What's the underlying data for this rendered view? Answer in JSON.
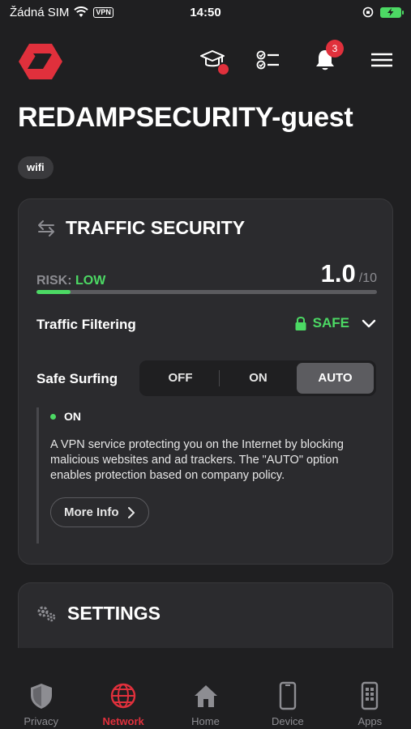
{
  "status_bar": {
    "carrier": "Žádná SIM",
    "vpn": "VPN",
    "time": "14:50"
  },
  "header": {
    "notification_count": "3"
  },
  "page": {
    "title": "REDAMPSECURITY-guest",
    "tag": "wifi"
  },
  "traffic_card": {
    "title": "TRAFFIC SECURITY",
    "risk_label": "RISK:",
    "risk_value": "LOW",
    "score": "1.0",
    "score_max": "/10",
    "risk_fraction": 0.1,
    "filtering_label": "Traffic Filtering",
    "filtering_status": "SAFE",
    "safe_surfing_label": "Safe Surfing",
    "safe_surfing_options": [
      "OFF",
      "ON",
      "AUTO"
    ],
    "safe_surfing_selected": "AUTO",
    "detail_status": "ON",
    "detail_description": "A VPN service protecting you on the Internet by blocking malicious websites and ad trackers. The \"AUTO\" option enables protection based on company policy.",
    "more_info_label": "More Info"
  },
  "settings_card": {
    "title": "SETTINGS"
  },
  "bottom_nav": {
    "items": [
      {
        "label": "Privacy",
        "icon": "shield-icon"
      },
      {
        "label": "Network",
        "icon": "globe-icon"
      },
      {
        "label": "Home",
        "icon": "home-icon"
      },
      {
        "label": "Device",
        "icon": "phone-icon"
      },
      {
        "label": "Apps",
        "icon": "apps-icon"
      }
    ],
    "active": "Network"
  },
  "colors": {
    "background": "#1f1f21",
    "card": "#2b2b2e",
    "accent_red": "#e0303c",
    "safe_green": "#4cd964",
    "muted": "#8d8d92"
  }
}
